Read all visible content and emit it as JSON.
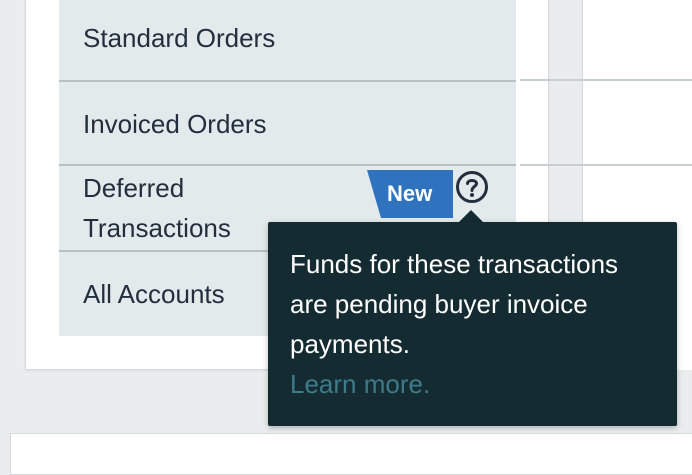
{
  "menu": {
    "items": [
      {
        "label": "Standard Orders"
      },
      {
        "label": "Invoiced Orders"
      },
      {
        "label": "Deferred Transactions"
      },
      {
        "label": "All Accounts"
      }
    ]
  },
  "badge": {
    "label": "New",
    "color": "#2f73bf"
  },
  "help": {
    "icon": "question-circle-icon"
  },
  "tooltip": {
    "text": "Funds for these transactions are pending buyer invoice payments.",
    "link": "Learn more."
  },
  "colors": {
    "tooltip_bg": "#152b32",
    "link": "#3e7a89",
    "menu_bg": "#e3eaec"
  }
}
